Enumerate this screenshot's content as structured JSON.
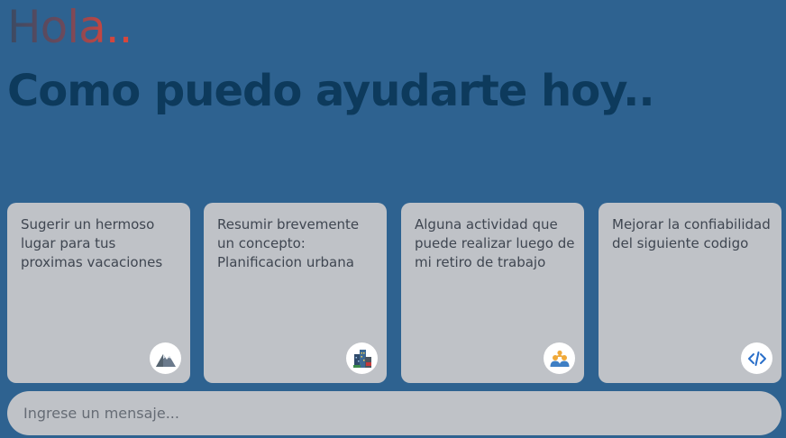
{
  "header": {
    "greeting": "Hola..",
    "headline": "Como puedo ayudarte hoy.."
  },
  "cards": [
    {
      "text": "Sugerir un hermoso lugar para tus proximas vacaciones",
      "icon": "mountain-icon"
    },
    {
      "text": "Resumir brevemente un concepto: Planificacion urbana",
      "icon": "city-buildings-icon"
    },
    {
      "text": "Alguna actividad que puede realizar luego de mi retiro de trabajo",
      "icon": "people-icon"
    },
    {
      "text": "Mejorar la confiabilidad del siguiente codigo",
      "icon": "code-icon"
    }
  ],
  "input": {
    "placeholder": "Ingrese un mensaje..."
  },
  "colors": {
    "background": "#2e6290",
    "headline": "#0d3a5c",
    "card": "#bfc2c7",
    "greeting_gradient_start": "#3a4a63",
    "greeting_gradient_end": "#d9483c"
  }
}
